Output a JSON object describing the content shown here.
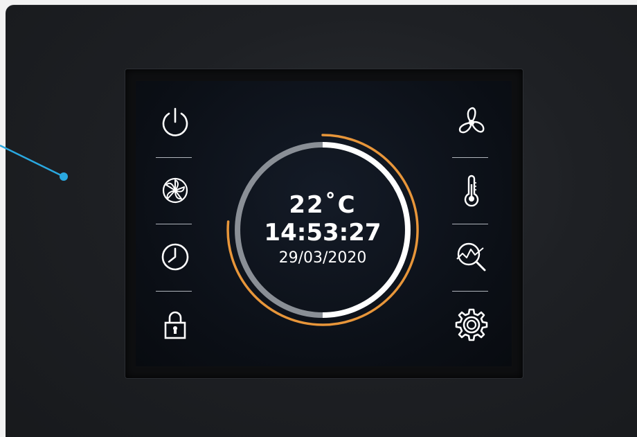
{
  "display": {
    "temperature": "22˚C",
    "time": "14:53:27",
    "date": "29/03/2020"
  },
  "colors": {
    "accent": "#e8963a",
    "ring_white": "#ffffff",
    "ring_gray": "#8a8f96",
    "callout": "#2aa8e0"
  },
  "left_buttons": [
    {
      "icon": "power-icon"
    },
    {
      "icon": "fan-speed-icon"
    },
    {
      "icon": "clock-icon"
    },
    {
      "icon": "lock-icon"
    }
  ],
  "right_buttons": [
    {
      "icon": "fan-icon"
    },
    {
      "icon": "thermometer-icon"
    },
    {
      "icon": "chart-search-icon"
    },
    {
      "icon": "gear-icon"
    }
  ]
}
